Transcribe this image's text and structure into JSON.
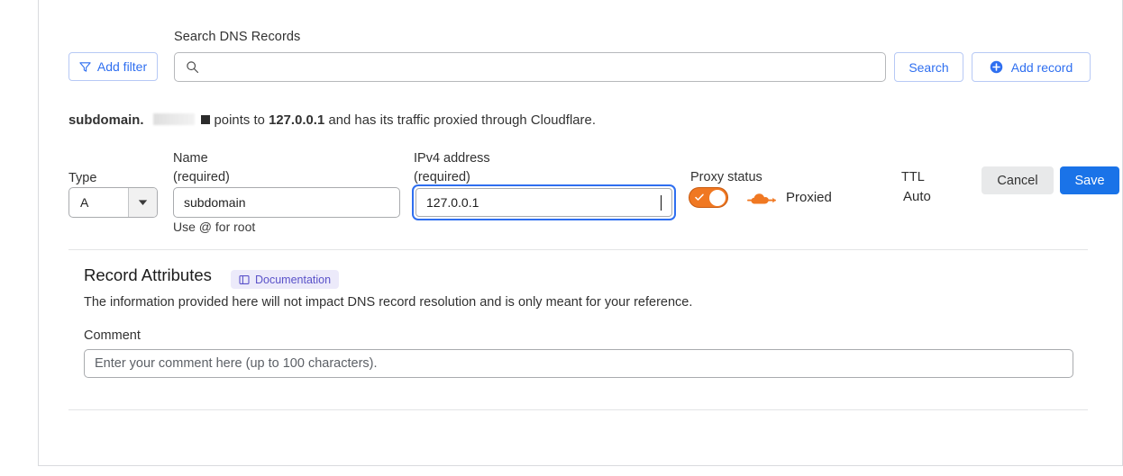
{
  "toolbar": {
    "add_filter_label": "Add filter",
    "search_label": "Search DNS Records",
    "search_value": "",
    "search_placeholder": "",
    "search_button_label": "Search",
    "add_record_label": "Add record"
  },
  "summary": {
    "subdomain": "subdomain.",
    "redacted_domain": "",
    "points_to": "points to",
    "ip": "127.0.0.1",
    "tail": "and has its traffic proxied through Cloudflare."
  },
  "record": {
    "type_label": "Type",
    "type_value": "A",
    "name_label_line1": "Name",
    "name_label_line2": "(required)",
    "name_value": "subdomain",
    "name_hint": "Use @ for root",
    "ipv4_label_line1": "IPv4 address",
    "ipv4_label_line2": "(required)",
    "ipv4_value": "127.0.0.1",
    "proxy_label": "Proxy status",
    "proxy_state": "Proxied",
    "ttl_label": "TTL",
    "ttl_value": "Auto"
  },
  "attributes": {
    "heading": "Record Attributes",
    "doc_badge_label": "Documentation",
    "description": "The information provided here will not impact DNS record resolution and is only meant for your reference.",
    "comment_label": "Comment",
    "comment_value": "",
    "comment_placeholder": "Enter your comment here (up to 100 characters)."
  },
  "footer": {
    "cancel_label": "Cancel",
    "save_label": "Save"
  },
  "colors": {
    "accent_blue": "#2f6ff0",
    "save_blue": "#1a73e8",
    "proxy_orange": "#f07822",
    "badge_purple": "#5a52c9"
  }
}
